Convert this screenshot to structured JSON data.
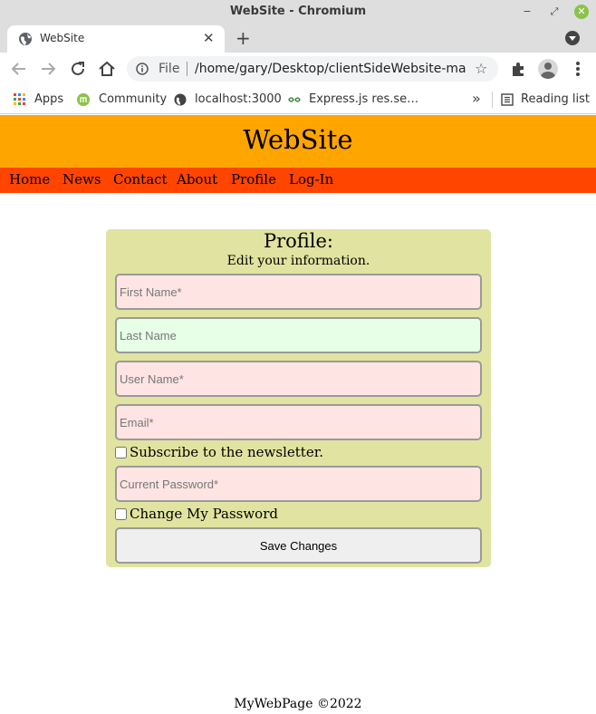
{
  "window": {
    "title": "WebSite - Chromium",
    "minimize_glyph": "−",
    "maximize_glyph": "⤢",
    "close_glyph": "✕"
  },
  "tab": {
    "label": "WebSite",
    "close_glyph": "✕",
    "new_tab_glyph": "+"
  },
  "address_bar": {
    "scheme_label": "File",
    "url": "/home/gary/Desktop/clientSideWebsite-mai…",
    "star_glyph": "☆"
  },
  "bookmarks": {
    "items": [
      {
        "label": "Apps",
        "icon": "apps-grid-icon"
      },
      {
        "label": "Community",
        "icon": "mint-icon"
      },
      {
        "label": "localhost:3000",
        "icon": "globe-icon"
      },
      {
        "label": "Express.js res.se…",
        "icon": "express-icon"
      }
    ],
    "more_glyph": "»",
    "reading_list": "Reading list"
  },
  "site": {
    "title": "WebSite",
    "nav": [
      "Home",
      "News",
      "Contact",
      "About",
      "Profile",
      "Log-In"
    ],
    "colors": {
      "header": "#ffa500",
      "nav": "#ff4500",
      "card": "#e0e4a0"
    }
  },
  "profile_form": {
    "heading": "Profile:",
    "subheading": "Edit your information.",
    "first_name": {
      "placeholder": "First Name*",
      "value": ""
    },
    "last_name": {
      "placeholder": "Last Name",
      "value": ""
    },
    "user_name": {
      "placeholder": "User Name*",
      "value": ""
    },
    "email": {
      "placeholder": "Email*",
      "value": ""
    },
    "newsletter": {
      "label": "Subscribe to the newsletter.",
      "checked": false
    },
    "current_password": {
      "placeholder": "Current Password*",
      "value": ""
    },
    "change_password": {
      "label": "Change My Password",
      "checked": false
    },
    "save_label": "Save Changes"
  },
  "footer": {
    "text": "MyWebPage ©2022"
  }
}
